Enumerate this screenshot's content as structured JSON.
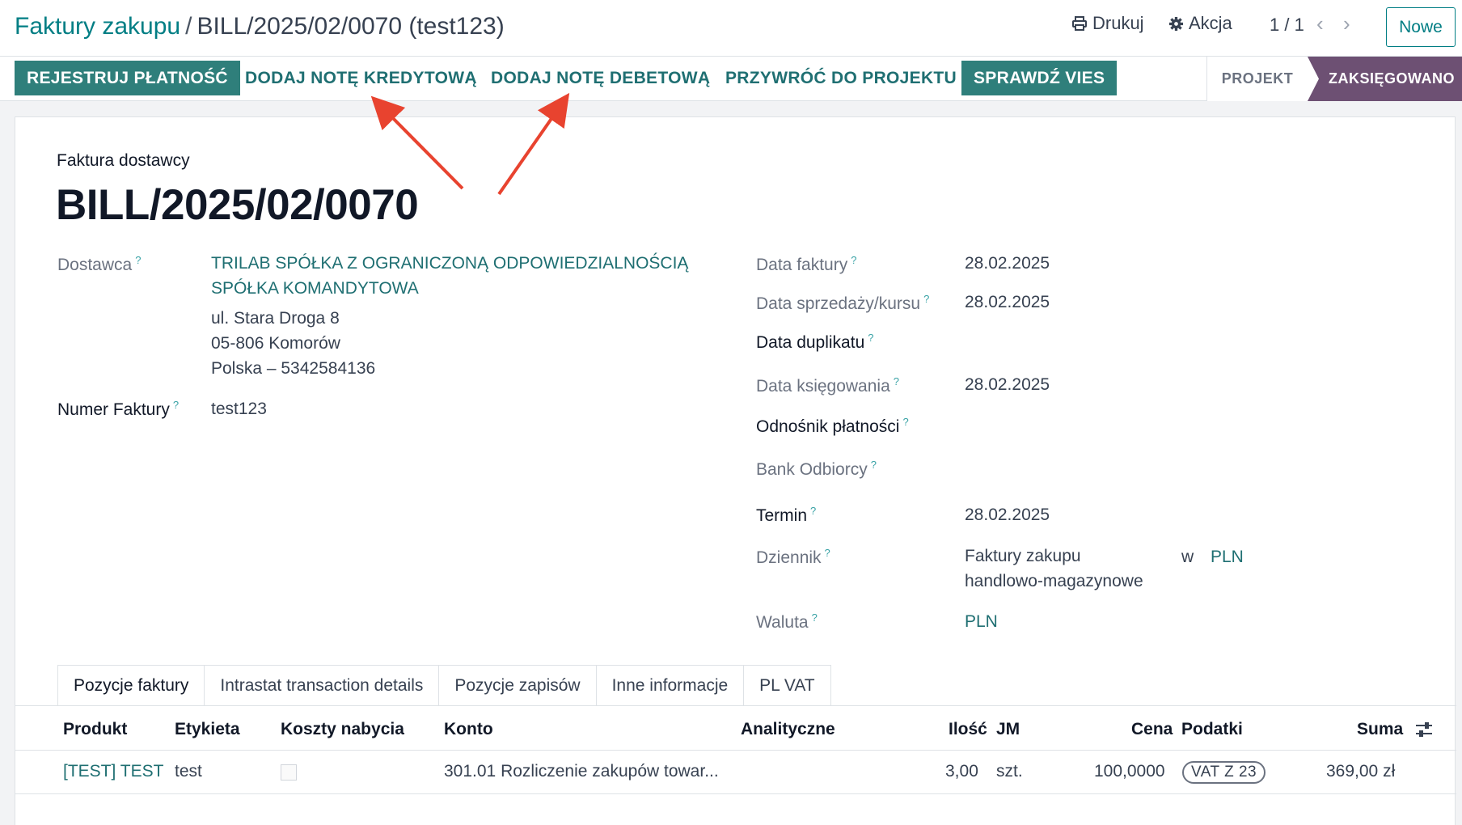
{
  "breadcrumb": {
    "parent": "Faktury zakupu",
    "separator": "/",
    "current": "BILL/2025/02/0070 (test123)"
  },
  "toolbar": {
    "print_label": "Drukuj",
    "action_label": "Akcja",
    "pager": "1 / 1",
    "new_label": "Nowe"
  },
  "status_buttons": {
    "register_payment": "REJESTRUJ PŁATNOŚĆ",
    "credit_note": "DODAJ NOTĘ KREDYTOWĄ",
    "debit_note": "DODAJ NOTĘ DEBETOWĄ",
    "reset_draft": "PRZYWRÓĆ DO PROJEKTU",
    "check_vies": "SPRAWDŹ VIES"
  },
  "stages": {
    "draft": "PROJEKT",
    "posted": "ZAKSIĘGOWANO"
  },
  "document": {
    "type_label": "Faktura dostawcy",
    "name": "BILL/2025/02/0070"
  },
  "left_fields": {
    "vendor_label": "Dostawca",
    "vendor_name_line1": "TRILAB SPÓŁKA Z OGRANICZONĄ ODPOWIEDZIALNOŚCIĄ",
    "vendor_name_line2": "SPÓŁKA KOMANDYTOWA",
    "vendor_address1": "ul. Stara Droga 8",
    "vendor_address2": "05-806 Komorów",
    "vendor_address3": "Polska – 5342584136",
    "invoice_number_label": "Numer Faktury",
    "invoice_number": "test123"
  },
  "right_fields": {
    "invoice_date_label": "Data faktury",
    "invoice_date": "28.02.2025",
    "sale_date_label": "Data sprzedaży/kursu",
    "sale_date": "28.02.2025",
    "duplicate_date_label": "Data duplikatu",
    "accounting_date_label": "Data księgowania",
    "accounting_date": "28.02.2025",
    "payment_ref_label": "Odnośnik płatności",
    "bank_label": "Bank Odbiorcy",
    "due_label": "Termin",
    "due_date": "28.02.2025",
    "journal_label": "Dziennik",
    "journal_line1": "Faktury zakupu",
    "journal_line2": "handlowo-magazynowe",
    "journal_in": "w",
    "journal_currency": "PLN",
    "currency_label": "Waluta",
    "currency": "PLN"
  },
  "tabs": [
    "Pozycje faktury",
    "Intrastat transaction details",
    "Pozycje zapisów",
    "Inne informacje",
    "PL VAT"
  ],
  "table": {
    "headers": [
      "Produkt",
      "Etykieta",
      "Koszty nabycia",
      "Konto",
      "Analityczne",
      "Ilość",
      "JM",
      "Cena",
      "Podatki",
      "Suma"
    ],
    "rows": [
      {
        "product": "[TEST] TEST",
        "label": "test",
        "account": "301.01 Rozliczenie zakupów towar...",
        "quantity": "3,00",
        "uom": "szt.",
        "price": "100,0000",
        "tax": "VAT Z 23",
        "total": "369,00 zł"
      }
    ]
  },
  "colors": {
    "accent": "#017e84",
    "primary_button": "#2f7f7b",
    "stage_active": "#6d5073",
    "annotation_arrow": "#e8432f"
  },
  "icons": {
    "print": "printer-icon",
    "action": "gear-icon",
    "prev": "chevron-left-icon",
    "next": "chevron-right-icon",
    "optional_columns": "sliders-icon"
  }
}
